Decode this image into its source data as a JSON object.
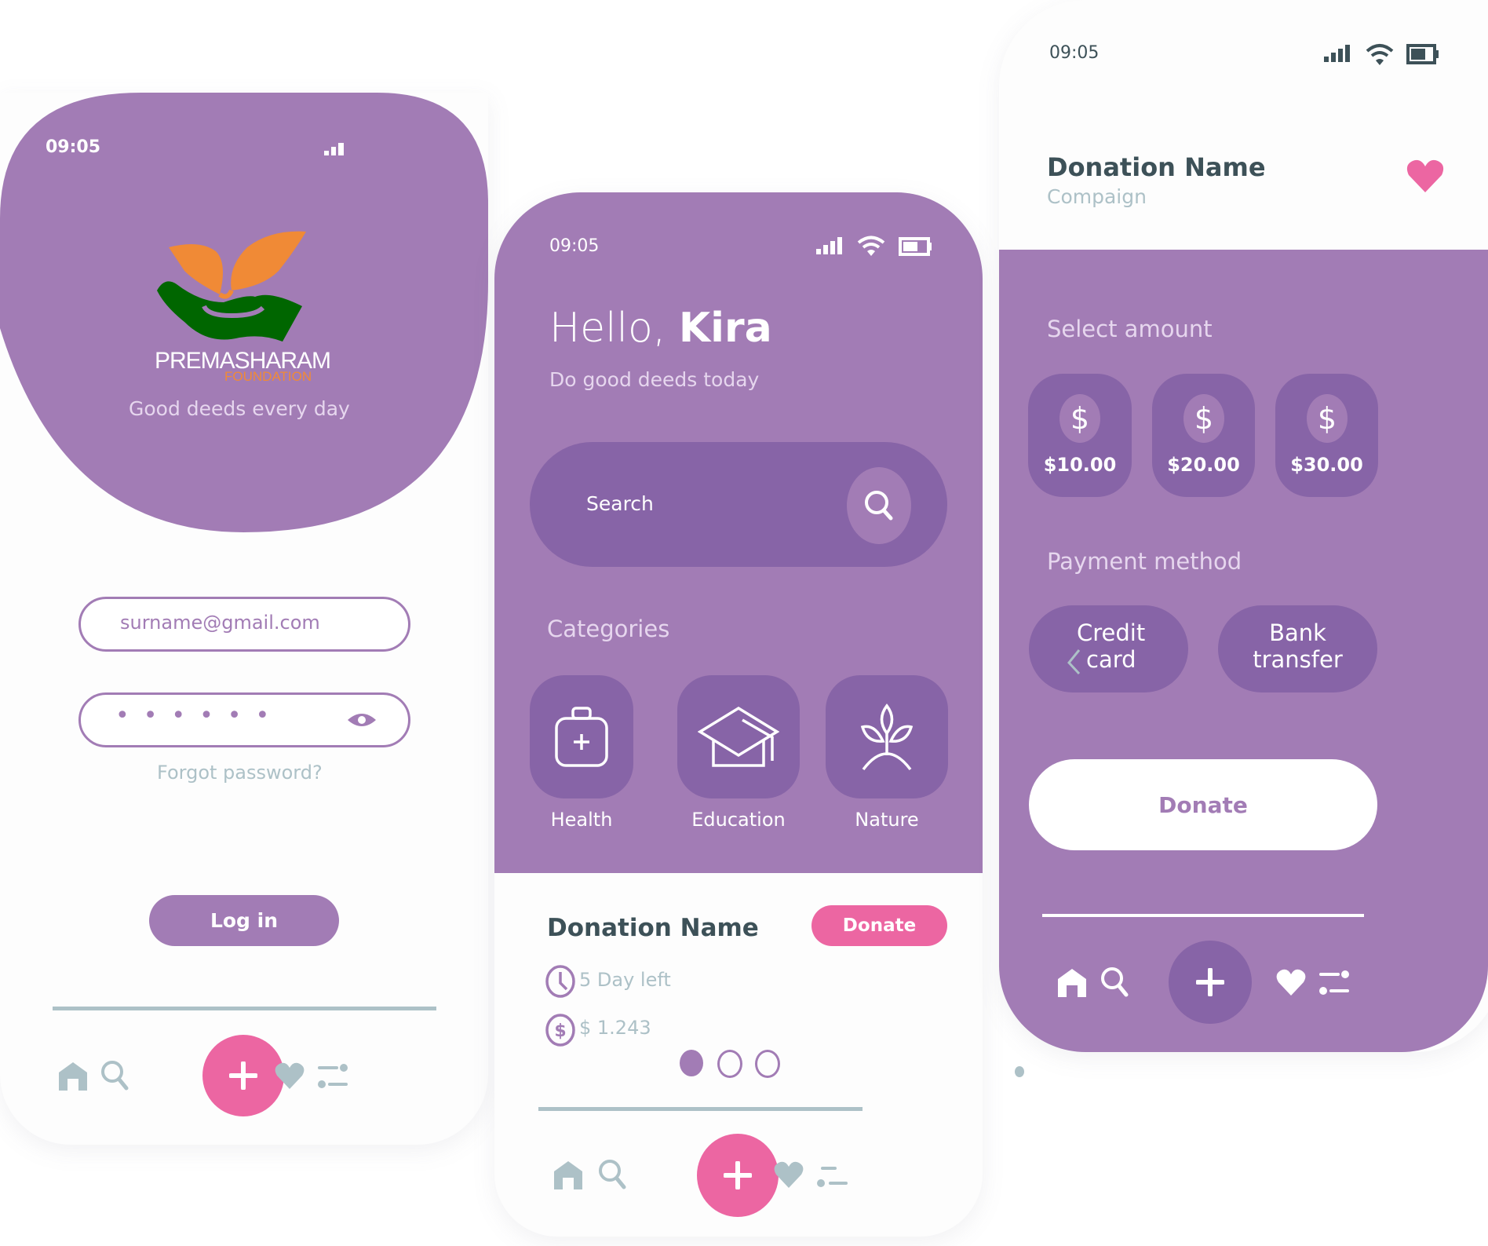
{
  "colors": {
    "purple": "#a27cb5",
    "purple_dark": "#8764a7",
    "pink": "#ec66a2",
    "gray": "#adc1c7",
    "slate": "#3d5158",
    "lavender_text": "#e6d6ee",
    "logo_orange": "#f08a36",
    "logo_green": "#006600"
  },
  "login_screen": {
    "status_time": "09:05",
    "brand_name": "PREMASHARAM",
    "brand_sub": "FOUNDATION",
    "tagline": "Good deeds every day",
    "email_value": "surname@gmail.com",
    "password_mask": "••••••",
    "forgot_link": "Forgot password?",
    "login_button": "Log in",
    "nav": [
      "home-icon",
      "search-icon",
      "plus-icon",
      "heart-icon",
      "filter-icon"
    ]
  },
  "home_screen": {
    "status_time": "09:05",
    "greeting_prefix": "Hello,",
    "greeting_name": "Kira",
    "subtitle": "Do good deeds today",
    "search_placeholder": "Search",
    "categories_title": "Categories",
    "categories": [
      {
        "label": "Health",
        "icon": "medical-kit-icon"
      },
      {
        "label": "Education",
        "icon": "graduation-cap-icon"
      },
      {
        "label": "Nature",
        "icon": "plant-icon"
      }
    ],
    "donation": {
      "name": "Donation Name",
      "donate_button": "Donate",
      "days_left": "5 Day left",
      "amount": "$ 1.243"
    },
    "pager": {
      "total": 3,
      "active": 0
    },
    "nav": [
      "home-icon",
      "search-icon",
      "plus-icon",
      "heart-icon",
      "filter-icon"
    ]
  },
  "donate_screen": {
    "status_time": "09:05",
    "title": "Donation Name",
    "subtitle": "Compaign",
    "select_amount_title": "Select amount",
    "amounts": [
      "$10.00",
      "$20.00",
      "$30.00"
    ],
    "payment_title": "Payment method",
    "payment_methods": [
      {
        "line1": "Credit",
        "line2": "card"
      },
      {
        "line1": "Bank",
        "line2": "transfer"
      }
    ],
    "donate_button": "Donate",
    "nav": [
      "home-icon",
      "search-icon",
      "plus-icon",
      "heart-icon",
      "filter-icon"
    ]
  }
}
